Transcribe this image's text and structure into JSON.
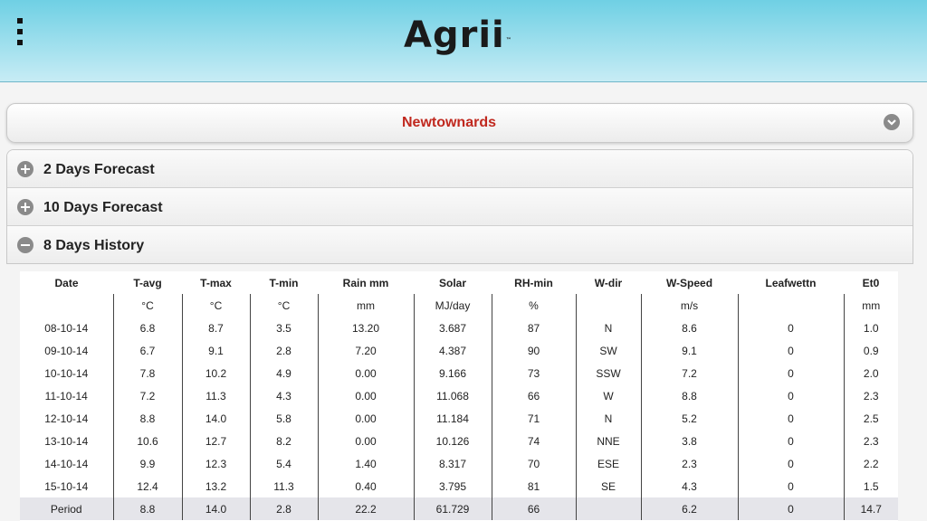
{
  "header": {
    "logo_text": "Agrii",
    "logo_tm": "™",
    "menu_icon": "vertical-dots-icon"
  },
  "location": {
    "selected": "Newtownards",
    "icon": "chevron-down-icon",
    "accent_color": "#c0281e"
  },
  "accordion": [
    {
      "label": "2 Days Forecast",
      "icon": "plus-circle-icon",
      "expanded": false
    },
    {
      "label": "10 Days Forecast",
      "icon": "plus-circle-icon",
      "expanded": false
    },
    {
      "label": "8 Days History",
      "icon": "minus-circle-icon",
      "expanded": true
    }
  ],
  "history_table": {
    "columns": [
      "Date",
      "T-avg",
      "T-max",
      "T-min",
      "Rain mm",
      "Solar",
      "RH-min",
      "W-dir",
      "W-Speed",
      "Leafwettn",
      "Et0"
    ],
    "units": [
      "",
      "°C",
      "°C",
      "°C",
      "mm",
      "MJ/day",
      "%",
      "",
      "m/s",
      "",
      "mm"
    ],
    "rows": [
      [
        "08-10-14",
        "6.8",
        "8.7",
        "3.5",
        "13.20",
        "3.687",
        "87",
        "N",
        "8.6",
        "0",
        "1.0"
      ],
      [
        "09-10-14",
        "6.7",
        "9.1",
        "2.8",
        "7.20",
        "4.387",
        "90",
        "SW",
        "9.1",
        "0",
        "0.9"
      ],
      [
        "10-10-14",
        "7.8",
        "10.2",
        "4.9",
        "0.00",
        "9.166",
        "73",
        "SSW",
        "7.2",
        "0",
        "2.0"
      ],
      [
        "11-10-14",
        "7.2",
        "11.3",
        "4.3",
        "0.00",
        "11.068",
        "66",
        "W",
        "8.8",
        "0",
        "2.3"
      ],
      [
        "12-10-14",
        "8.8",
        "14.0",
        "5.8",
        "0.00",
        "11.184",
        "71",
        "N",
        "5.2",
        "0",
        "2.5"
      ],
      [
        "13-10-14",
        "10.6",
        "12.7",
        "8.2",
        "0.00",
        "10.126",
        "74",
        "NNE",
        "3.8",
        "0",
        "2.3"
      ],
      [
        "14-10-14",
        "9.9",
        "12.3",
        "5.4",
        "1.40",
        "8.317",
        "70",
        "ESE",
        "2.3",
        "0",
        "2.2"
      ],
      [
        "15-10-14",
        "12.4",
        "13.2",
        "11.3",
        "0.40",
        "3.795",
        "81",
        "SE",
        "4.3",
        "0",
        "1.5"
      ]
    ],
    "period": [
      "Period",
      "8.8",
      "14.0",
      "2.8",
      "22.2",
      "61.729",
      "66",
      "",
      "6.2",
      "0",
      "14.7"
    ]
  }
}
